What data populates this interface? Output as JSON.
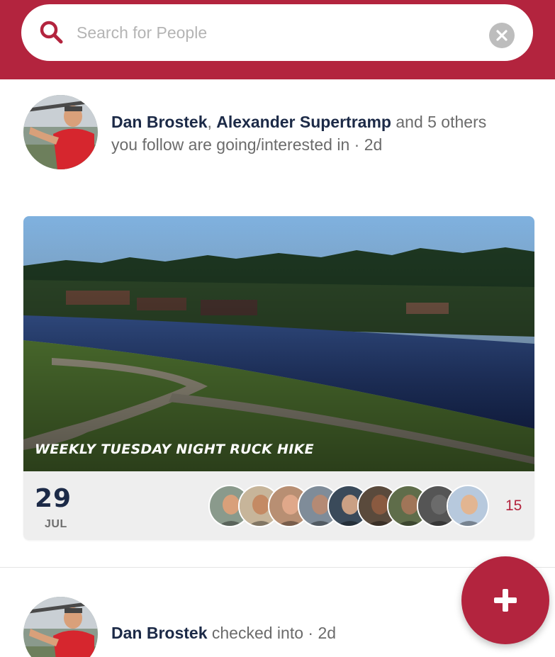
{
  "search": {
    "placeholder": "Search for People",
    "icon": "search-icon",
    "clear_icon": "close-icon"
  },
  "feed": [
    {
      "names": [
        "Dan Brostek",
        "Alexander Supertramp"
      ],
      "separator": ",",
      "rest_line": "and 5 others",
      "second_line": "you follow are going/interested in",
      "dot": "·",
      "time": "2d"
    },
    {
      "name": "Dan Brostek",
      "action": "checked into",
      "dot": "·",
      "time": "2d"
    }
  ],
  "event": {
    "title": "WEEKLY TUESDAY NIGHT RUCK HIKE",
    "day": "29",
    "month": "JUL",
    "attendee_count": "15",
    "attendee_avatar_count": 9
  },
  "fab": {
    "label": "+",
    "icon": "plus-icon"
  },
  "colors": {
    "brand": "#b3243e",
    "name_text": "#1c2a47",
    "muted_text": "#6b6b6b",
    "card_bg": "#eeeeee"
  }
}
